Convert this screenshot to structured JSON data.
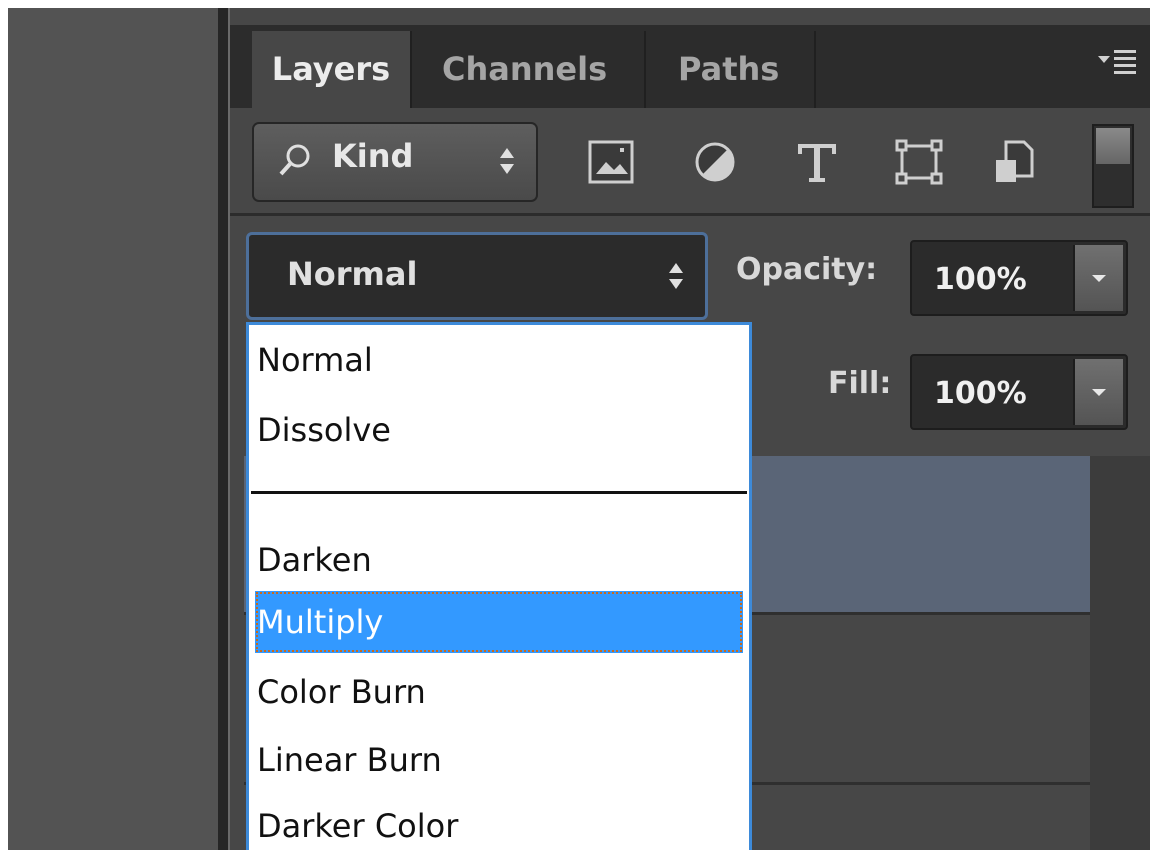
{
  "panel": {
    "tabs": [
      "Layers",
      "Channels",
      "Paths"
    ],
    "active_tab": "Layers"
  },
  "filter": {
    "kind_label": "Kind",
    "icons": [
      "pixel-layer-filter-icon",
      "adjustment-layer-filter-icon",
      "type-layer-filter-icon",
      "shape-layer-filter-icon",
      "smart-object-filter-icon"
    ]
  },
  "blend_mode": {
    "selected": "Normal",
    "options_visible": [
      "Normal",
      "Dissolve",
      "",
      "Darken",
      "Multiply",
      "Color Burn",
      "Linear Burn",
      "Darker Color"
    ],
    "highlighted": "Multiply"
  },
  "opacity": {
    "label": "Opacity:",
    "value": "100%"
  },
  "fill": {
    "label": "Fill:",
    "value": "100%"
  },
  "colors": {
    "panel_bg": "#474747",
    "dropdown_highlight": "#3399ff",
    "focus_border": "#3d8ad9",
    "selected_layer": "#5a6577"
  }
}
